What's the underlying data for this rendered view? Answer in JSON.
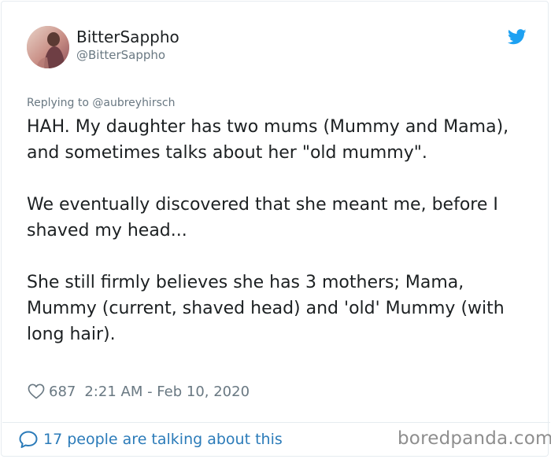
{
  "author": {
    "display_name": "BitterSappho",
    "handle": "@BitterSappho"
  },
  "icons": {
    "brand": "twitter-bird-icon",
    "like": "heart-icon",
    "conversation": "speech-bubble-icon"
  },
  "colors": {
    "twitter_blue": "#1da1f2",
    "link_blue": "#2b7bb9",
    "meta_gray": "#697882",
    "text": "#1c2022"
  },
  "tweet": {
    "replying_to": "Replying to @aubreyhirsch",
    "paragraphs": [
      "HAH. My daughter has two mums (Mummy and Mama), and sometimes talks about her \"old mummy\".",
      "We eventually discovered that she meant me, before I shaved my head...",
      "She still firmly believes she has 3 mothers; Mama, Mummy (current, shaved head) and 'old' Mummy (with long hair)."
    ],
    "likes": "687",
    "timestamp": "2:21 AM - Feb 10, 2020"
  },
  "footer": {
    "talking": "17 people are talking about this",
    "watermark": "boredpanda.com"
  }
}
